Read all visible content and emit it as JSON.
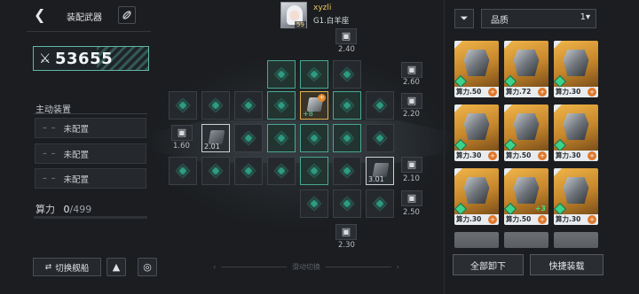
{
  "header": {
    "back_icon": "back-arrow-icon",
    "title": "装配武器",
    "title_icon": "wrench-icon"
  },
  "player": {
    "name": "xyzli",
    "rank": "G1.白羊座",
    "level": "59"
  },
  "power": {
    "icon": "crossed-swords-icon",
    "value": "53655"
  },
  "main_equipment": {
    "label": "主动装置",
    "slots": [
      {
        "dash": "– –",
        "label": "未配置"
      },
      {
        "dash": "– –",
        "label": "未配置"
      },
      {
        "dash": "– –",
        "label": "未配置"
      }
    ]
  },
  "compute": {
    "label": "算力",
    "current": "0",
    "max": "/499"
  },
  "bottom_left": {
    "switch_ship": "切换舰船",
    "switch_icon": "swap-icon",
    "btn2_icon": "radar-icon",
    "btn3_icon": "target-icon"
  },
  "swipe_hint": "滑动切换",
  "grid": {
    "locks": [
      {
        "value": "2.40"
      },
      {
        "value": "2.60"
      },
      {
        "value": "2.20"
      },
      {
        "value": "1.60"
      },
      {
        "value": "2.10"
      },
      {
        "value": "2.50"
      },
      {
        "value": "2.30"
      }
    ],
    "items": [
      {
        "value": "2.01"
      },
      {
        "value": "+8"
      },
      {
        "value": "3.01"
      }
    ]
  },
  "filter": {
    "icon": "filter-icon",
    "quality_label": "品质",
    "sort_icon": "sort-icon"
  },
  "inventory": [
    {
      "label": "算力.50",
      "has_plus": true,
      "upgrade": ""
    },
    {
      "label": "算力.72",
      "has_plus": true,
      "upgrade": ""
    },
    {
      "label": "算力.30",
      "has_plus": true,
      "upgrade": ""
    },
    {
      "label": "算力.30",
      "has_plus": true,
      "upgrade": ""
    },
    {
      "label": "算力.50",
      "has_plus": true,
      "upgrade": ""
    },
    {
      "label": "算力.30",
      "has_plus": true,
      "upgrade": ""
    },
    {
      "label": "算力.30",
      "has_plus": true,
      "upgrade": ""
    },
    {
      "label": "算力.50",
      "has_plus": true,
      "upgrade": "+3"
    },
    {
      "label": "算力.30",
      "has_plus": true,
      "upgrade": ""
    }
  ],
  "actions": {
    "unload_all": "全部卸下",
    "quick_equip": "快捷装载"
  }
}
